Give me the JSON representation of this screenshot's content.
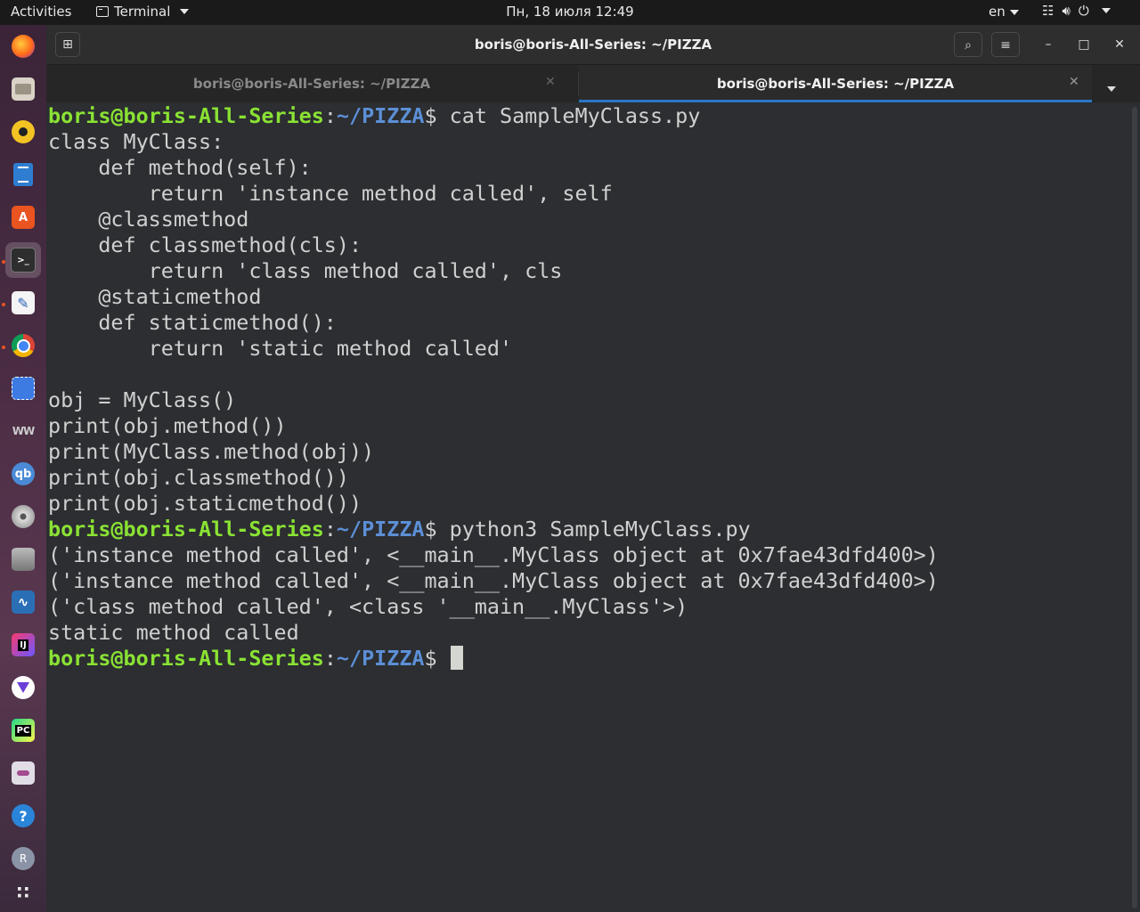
{
  "topbar": {
    "activities": "Activities",
    "app_name": "Terminal",
    "clock": "Пн, 18 июля  12:49",
    "language": "en",
    "tray_icons": [
      "network-icon",
      "volume-icon",
      "power-icon"
    ]
  },
  "dock": {
    "items": [
      "firefox-icon",
      "files-icon",
      "rhythmbox-icon",
      "writer-icon",
      "software-center-icon",
      "terminal-icon",
      "text-editor-icon",
      "chrome-icon",
      "screenshot-icon",
      "app-icon",
      "qbittorrent-icon",
      "disc-icon",
      "database-icon",
      "system-monitor-icon",
      "intellij-icon",
      "vpn-icon",
      "pycharm-icon",
      "tweaks-icon",
      "help-icon",
      "r-icon",
      "show-apps-icon"
    ],
    "active": "terminal-icon"
  },
  "window": {
    "title": "boris@boris-All-Series: ~/PIZZA",
    "tabs": [
      {
        "label": "boris@boris-All-Series: ~/PIZZA",
        "active": false
      },
      {
        "label": "boris@boris-All-Series: ~/PIZZA",
        "active": true
      }
    ]
  },
  "terminal": {
    "prompt_user": "boris@boris-All-Series",
    "prompt_path": "~/PIZZA",
    "prompt_symbol": "$",
    "command1": " cat SampleMyClass.py",
    "file_lines": [
      "class MyClass:",
      "    def method(self):",
      "        return 'instance method called', self",
      "    @classmethod",
      "    def classmethod(cls):",
      "        return 'class method called', cls",
      "    @staticmethod",
      "    def staticmethod():",
      "        return 'static method called'",
      "",
      "obj = MyClass()",
      "print(obj.method())",
      "print(MyClass.method(obj))",
      "print(obj.classmethod())",
      "print(obj.staticmethod())"
    ],
    "command2": " python3 SampleMyClass.py",
    "output_lines": [
      "('instance method called', <__main__.MyClass object at 0x7fae43dfd400>)",
      "('instance method called', <__main__.MyClass object at 0x7fae43dfd400>)",
      "('class method called', <class '__main__.MyClass'>)",
      "static method called"
    ]
  },
  "colors": {
    "prompt_user": "#8ae234",
    "prompt_path": "#5c8fd6",
    "text": "#d0d0d0",
    "background": "#2c2e31",
    "tab_accent": "#2a76c6"
  }
}
